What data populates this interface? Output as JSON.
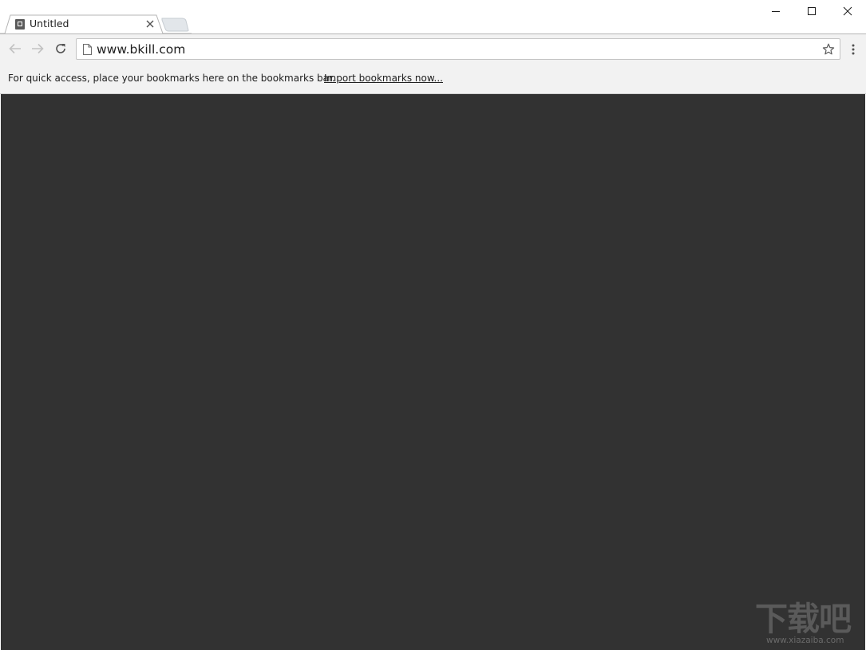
{
  "tab": {
    "title": "Untitled",
    "icons": {
      "favicon": "page-folder-icon",
      "close": "close-icon"
    }
  },
  "window_controls": {
    "icons": {
      "minimize": "minimize-icon",
      "maximize": "maximize-icon",
      "close": "close-icon"
    }
  },
  "toolbar": {
    "url": "www.bkill.com",
    "icons": {
      "back": "arrow-left-icon",
      "forward": "arrow-right-icon",
      "reload": "reload-icon",
      "page": "page-icon",
      "bookmark": "star-icon",
      "menu": "kebab-menu-icon"
    }
  },
  "bookmarks_bar": {
    "message": "For quick access, place your bookmarks here on the bookmarks bar.",
    "import_link": "Import bookmarks now..."
  },
  "watermark": {
    "main": "下载吧",
    "sub": "www.xiazaiba.com"
  },
  "colors": {
    "content_background": "#323232",
    "toolbar_background": "#f2f2f2"
  }
}
